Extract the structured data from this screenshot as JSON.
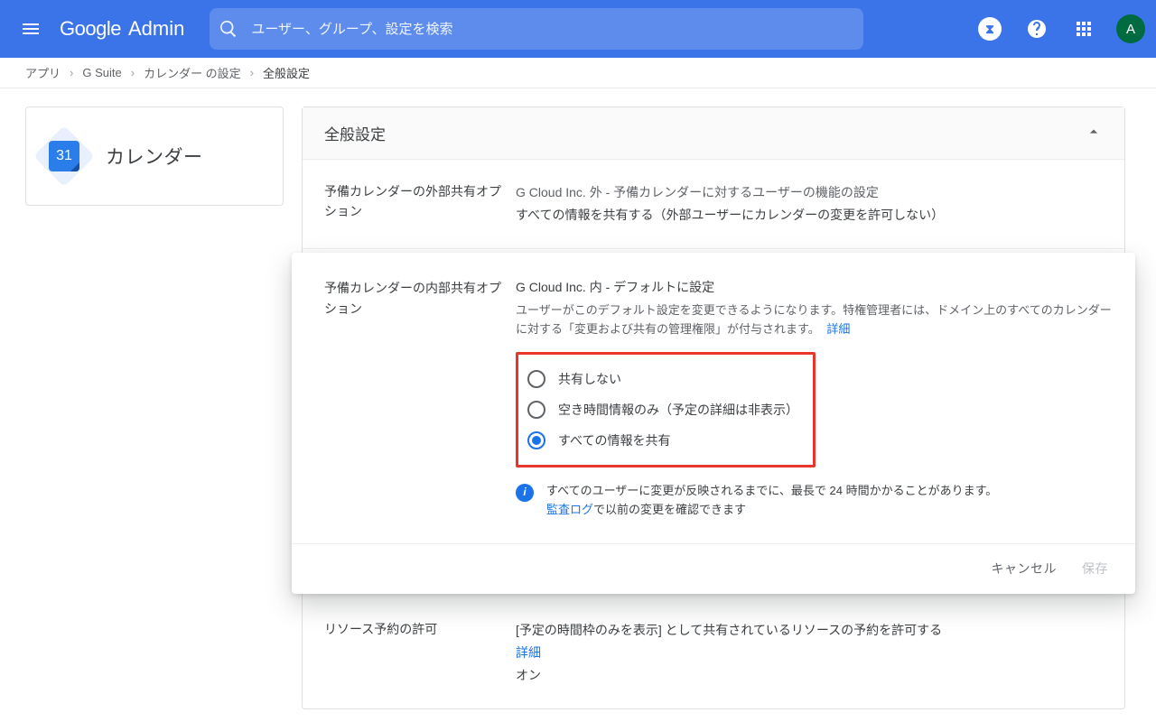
{
  "header": {
    "logo_google": "Google",
    "logo_admin": "Admin",
    "search_placeholder": "ユーザー、グループ、設定を検索",
    "avatar_letter": "A",
    "notif_glyph": "⧗"
  },
  "breadcrumb": {
    "items": [
      "アプリ",
      "G Suite",
      "カレンダー の設定"
    ],
    "current": "全般設定"
  },
  "sidebar_card": {
    "title": "カレンダー",
    "icon_day": "31"
  },
  "section": {
    "title": "全般設定"
  },
  "external_row": {
    "label": "予備カレンダーの外部共有オプション",
    "subtitle": "G Cloud Inc. 外 - 予備カレンダーに対するユーザーの機能の設定",
    "value": "すべての情報を共有する（外部ユーザーにカレンダーの変更を許可しない）"
  },
  "internal_panel": {
    "label": "予備カレンダーの内部共有オプション",
    "title": "G Cloud Inc. 内 - デフォルトに設定",
    "desc": "ユーザーがこのデフォルト設定を変更できるようになります。特権管理者には、ドメイン上のすべてのカレンダーに対する「変更および共有の管理権限」が付与されます。",
    "desc_link": "詳細",
    "options": [
      {
        "label": "共有しない",
        "selected": false
      },
      {
        "label": "空き時間情報のみ（予定の詳細は非表示）",
        "selected": false
      },
      {
        "label": "すべての情報を共有",
        "selected": true
      }
    ],
    "info": "すべてのユーザーに変更が反映されるまでに、最長で 24 時間かかることがあります。",
    "info_link": "監査ログ",
    "info_tail": "で以前の変更を確認できます",
    "cancel": "キャンセル",
    "save": "保存"
  },
  "resource_row": {
    "label": "リソース予約の許可",
    "title": "[予定の時間枠のみを表示] として共有されているリソースの予約を許可する",
    "link": "詳細",
    "value": "オン"
  }
}
